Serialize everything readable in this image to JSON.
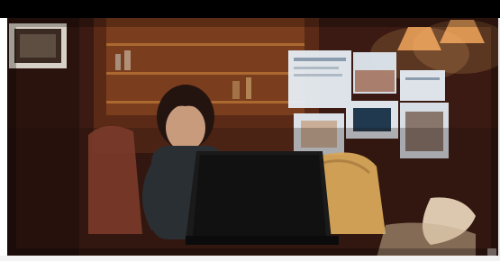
{
  "scene": {
    "description_labels": {
      "frame": "video-frame",
      "subject": "person-with-laptop"
    }
  },
  "colors": {
    "top_bar": "#000000",
    "wall_dark": "#2b1410",
    "wall_warm": "#8a3f1c",
    "lamp_glow": "#f2a35a",
    "laptop": "#1a1a1a",
    "skin": "#c89b7c",
    "hair": "#241410",
    "pillow": "#d7a65a",
    "screen_panel": "#e7eef5"
  },
  "icons": {
    "corner_badge": "video-corner-badge-icon"
  }
}
